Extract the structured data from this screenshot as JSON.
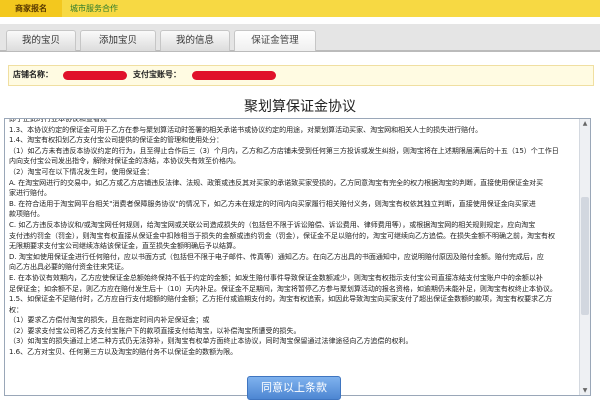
{
  "topbar": {
    "merchant_signup": "商家报名",
    "city_service": "城市服务合作"
  },
  "tabs": [
    "我的宝贝",
    "添加宝贝",
    "我的信息",
    "保证金管理"
  ],
  "shop": {
    "shop_name_label": "店铺名称：",
    "alipay_label": "支付宝账号："
  },
  "title": "聚划算保证金协议",
  "agreement_lines": [
    "即于正此时行业本协议和查看规",
    "1.3、本协议约定的保证金可用于乙方在参与聚划算活动时签署的相关承诺书或协议约定的用途，对聚划算活动买家、淘宝网和相关人士的损失进行赔付。",
    "1.4、淘宝有权扣划乙方支付宝公司提供的保证金的管理和使用处分：",
    "（1）如乙方未有违反本协议约定的行为，且至得止合作后三（3）个月内，乙方和乙方店铺未受到任何第三方投诉或发生纠纷，则淘宝将在上述期限届满后的十五（15）个工作日",
    "内向支付宝公司发出指令，解除对保证金的冻结，本协议失有效至价格内。",
    "（2）淘宝可在以下情况发生时，使用保证金：",
    "    A. 在淘宝网进行的交易中，如乙方或乙方店铺违反法律、法规、政策或违反其对买家的承诺致买家受损的，乙方同意淘宝有完全的权力根据淘宝的判断，直接使用保证金对买",
    "家进行赔付。",
    "    B. 在符合适用于淘宝网平台相关\"消费者保障服务协议\"的情况下，如乙方未在规定的时间内向买家履行相关赔付义务，则淘宝有权依其独立判断，直接使用保证金向买家进",
    "款项赔付。",
    "    C. 如乙方违反本协议和/或淘宝网任何规则，给淘宝网或关联公司造成损失的（包括但不限于诉讼赔偿、诉讼费用、律师费用等），或根据淘宝网的相关规则规定，应向淘宝",
    "支付违约罚金（罚金），则淘宝有权直接从保证金中扣除相当于损失的金额或违约罚金（罚金），保证金不足以赔付的，淘宝可继续向乙方追偿。在损失金额不明确之前，淘宝有权",
    "无限期要求支付宝公司继续冻结该保证金，直至损失金额明确后予以结算。",
    "    D. 淘宝如使用保证金进行任何赔付，应以书面方式（包括但不限于电子邮件、传真等）通知乙方。在向乙方出具的书面通知中，应说明赔付原因及赔付金额。赔付完成后，应",
    "向乙方出具必要的赔付资金往来凭证。",
    "    E. 在本协议有效期内，乙方应使保证金总额始终保持不低于约定的金额；如发生赔付事件导致保证金数额减少，则淘宝有权指示支付宝公司直接冻结支付宝账户中的余额以补",
    "足保证金；如余额不足，则乙方应在赔付发生后十（10）天内补足。保证金不足期间，淘宝将暂停乙方参与聚划算活动的报名资格，如逾期仍未能补足，则淘宝有权终止本协议。",
    "1.5、如保证金不足赔付时，乙方应自行支付超额的赔付金额；乙方拒付或逾期支付的，淘宝有权追索，如因此导致淘宝向买家支付了超出保证金数额的款项，淘宝有权要求乙方",
    "权：",
    "（1）要求乙方偿付淘宝的损失，且在指定时间内补足保证金；或",
    "（2）要求支付宝公司将乙方支付宝账户下的款项直接支付给淘宝，以补偿淘宝所遭受的损失。",
    "（3）如淘宝的损失通过上述二种方式仍无法弥补，则淘宝有权单方面终止本协议，同时淘宝保留通过法律途径向乙方追偿的权利。",
    "1.6、乙方对宝贝、任何第三方以及淘宝的赔付务不以保证金的数额为限。"
  ],
  "agree_button": "同意以上条款",
  "colors": {
    "topbar": "#f7d943",
    "redaction": "#e0112a",
    "button": "#4d86d2"
  }
}
